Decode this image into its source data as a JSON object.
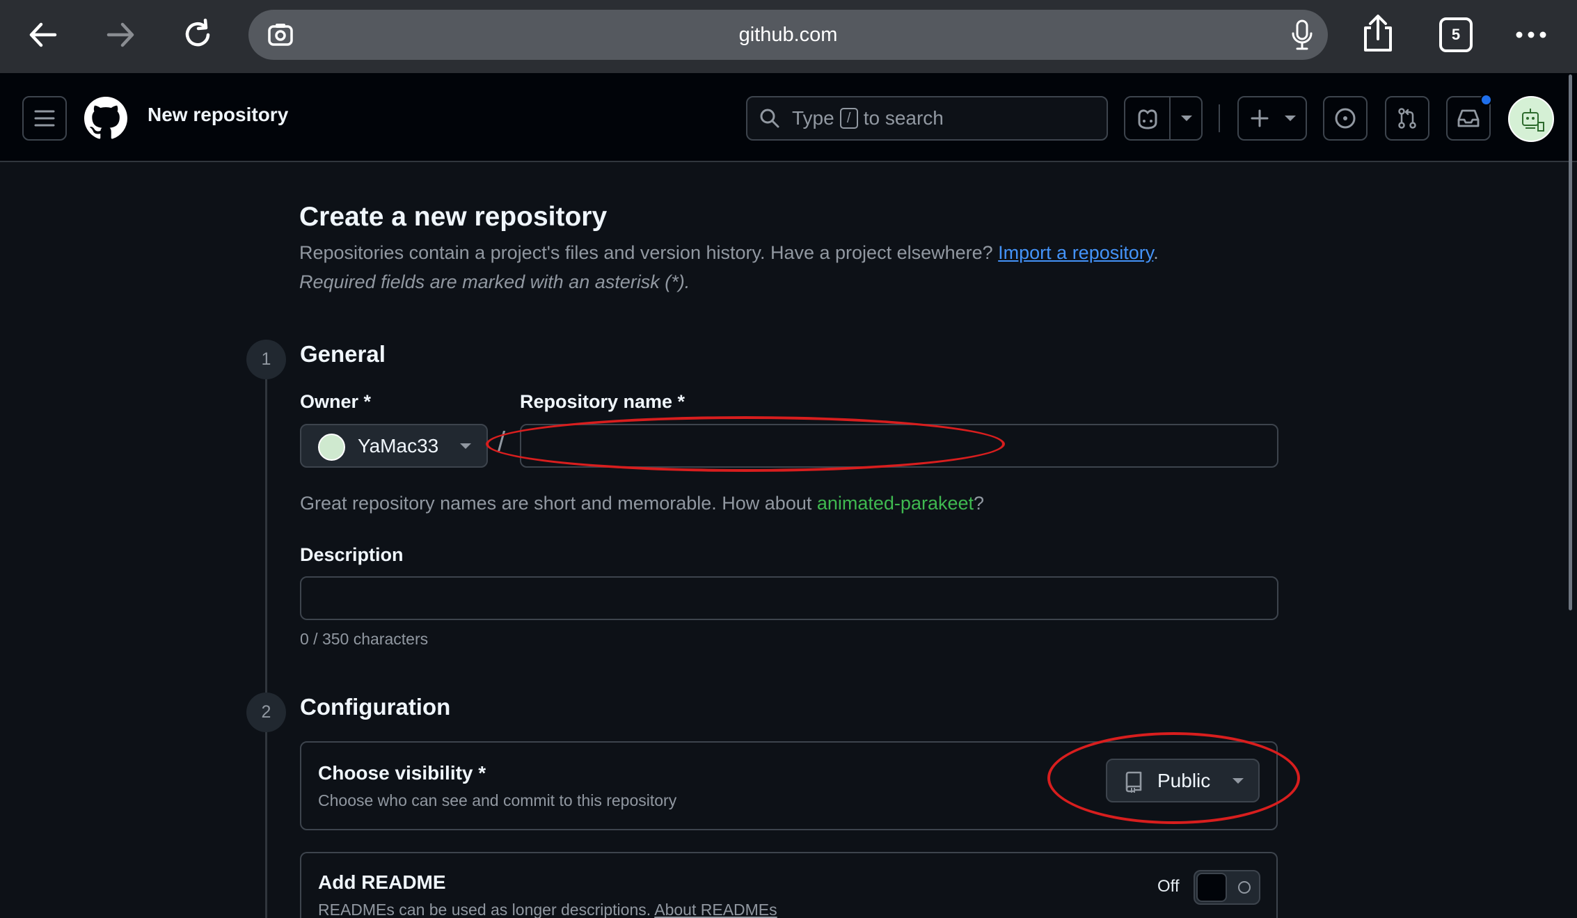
{
  "browser": {
    "url": "github.com",
    "tab_count": "5"
  },
  "header": {
    "page_name": "New repository",
    "search_prefix": "Type",
    "search_key": "/",
    "search_suffix": "to search"
  },
  "page": {
    "title": "Create a new repository",
    "subtitle_text": "Repositories contain a project's files and version history. Have a project elsewhere? ",
    "import_link": "Import a repository",
    "subtitle_end": ".",
    "required_note": "Required fields are marked with an asterisk (*)."
  },
  "general": {
    "step": "1",
    "title": "General",
    "owner_label": "Owner *",
    "owner_value": "YaMac33",
    "slash": "/",
    "repo_name_label": "Repository name *",
    "repo_name_value": "",
    "hint_prefix": "Great repository names are short and memorable. How about ",
    "hint_suggestion": "animated-parakeet",
    "hint_suffix": "?",
    "description_label": "Description",
    "description_value": "",
    "char_count": "0 / 350 characters"
  },
  "configuration": {
    "step": "2",
    "title": "Configuration",
    "visibility_title": "Choose visibility *",
    "visibility_desc": "Choose who can see and commit to this repository",
    "visibility_value": "Public",
    "readme_title": "Add README",
    "readme_desc": "READMEs can be used as longer descriptions. ",
    "readme_link": "About READMEs",
    "readme_toggle": "Off"
  },
  "colors": {
    "annotation": "#d81e1e",
    "link": "#4493f8",
    "suggestion": "#3fb950",
    "notification": "#1f6feb"
  }
}
